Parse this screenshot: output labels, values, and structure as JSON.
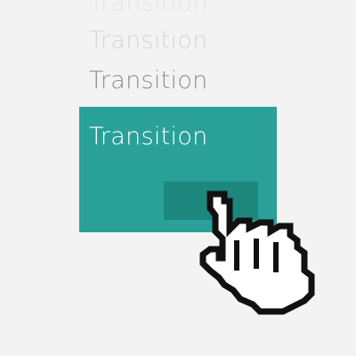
{
  "ghost_texts": [
    "Transition",
    "Transition",
    "Transition"
  ],
  "card": {
    "title": "Transition",
    "background": "#2aa198",
    "button_background": "#1d877e"
  },
  "cursor": {
    "icon": "pointing-hand-cursor-icon"
  },
  "colors": {
    "page_background": "#f3f3f3",
    "ghost_light": "#e6e6e6",
    "ghost_mid": "#d6d6d6",
    "ghost_dark": "#8f8f8f"
  }
}
